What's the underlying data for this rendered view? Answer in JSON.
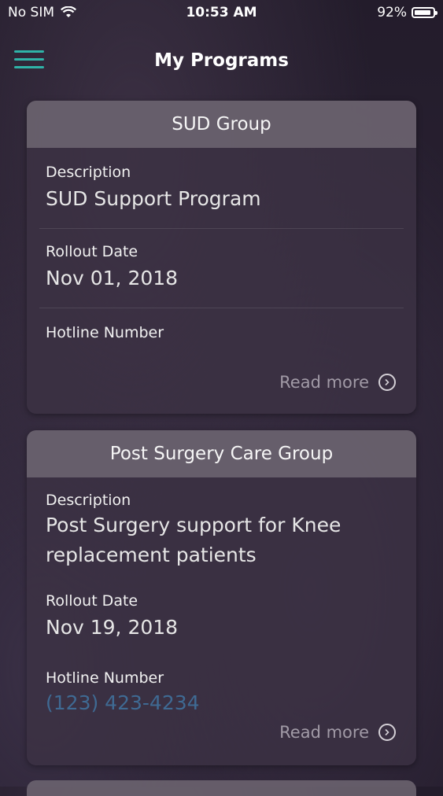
{
  "status_bar": {
    "carrier": "No SIM",
    "time": "10:53 AM",
    "battery_percent": "92%",
    "battery_level": 0.92
  },
  "nav": {
    "title": "My Programs",
    "menu_icon": "hamburger-menu-icon",
    "accent_color": "#2fb3a8"
  },
  "programs": [
    {
      "name": "SUD Group",
      "description_label": "Description",
      "description": "SUD Support Program",
      "rollout_label": "Rollout Date",
      "rollout_date": "Nov 01, 2018",
      "hotline_label": "Hotline Number",
      "hotline_number": "",
      "read_more": "Read more"
    },
    {
      "name": "Post Surgery Care Group",
      "description_label": "Description",
      "description": "Post Surgery support for Knee replacement patients",
      "rollout_label": "Rollout Date",
      "rollout_date": "Nov 19, 2018",
      "hotline_label": "Hotline Number",
      "hotline_number": "(123) 423-4234",
      "read_more": "Read more"
    }
  ]
}
